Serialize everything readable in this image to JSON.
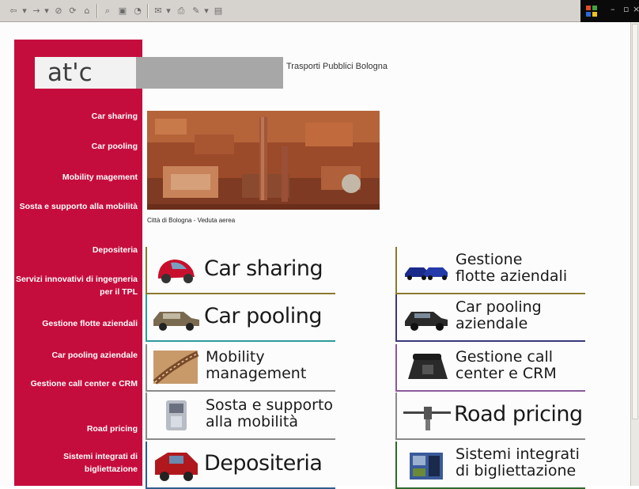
{
  "browser": {
    "toolbar_icons": [
      "back-arrow-icon",
      "forward-arrow-icon",
      "stop-icon",
      "refresh-icon",
      "home-icon",
      "search-icon",
      "favorites-icon",
      "history-icon",
      "mail-icon",
      "print-icon",
      "edit-icon",
      "discuss-icon"
    ]
  },
  "site": {
    "logo": "at'c",
    "title": "Trasporti Pubblici Bologna",
    "accent_color": "#c50d3d"
  },
  "sidebar": {
    "items": [
      {
        "label": "Car sharing"
      },
      {
        "label": "Car pooling"
      },
      {
        "label": "Mobility magement"
      },
      {
        "label": "Sosta e supporto alla mobilità"
      },
      {
        "label": "Depositeria"
      },
      {
        "label": "Servizi innovativi di ingegneria per il TPL"
      },
      {
        "label": "Gestione flotte aziendali"
      },
      {
        "label": "Car pooling aziendale"
      },
      {
        "label": "Gestione call center e CRM"
      },
      {
        "label": "Road pricing"
      },
      {
        "label": "Sistemi integrati di bigliettazione"
      }
    ]
  },
  "photo": {
    "caption": "Città di Bologna - Veduta aerea"
  },
  "tiles": {
    "left": [
      {
        "label": "Car sharing",
        "color": "#8a7a2e"
      },
      {
        "label": "Car pooling",
        "color": "#2e9a9a"
      },
      {
        "label": "Mobility\nmanagement",
        "color": "#8a8a8a"
      },
      {
        "label": "Sosta e supporto\nalla mobilità",
        "color": "#8a8a8a"
      },
      {
        "label": "Depositeria",
        "color": "#2e5e8a"
      }
    ],
    "right": [
      {
        "label": "Gestione\nflotte aziendali",
        "color": "#8a7a2e"
      },
      {
        "label": "Car pooling\naziendale",
        "color": "#3a3a7a"
      },
      {
        "label": "Gestione call\ncenter e CRM",
        "color": "#8a5a9a"
      },
      {
        "label": "Road pricing",
        "color": "#8a8a8a"
      },
      {
        "label": "Sistemi integrati\ndi bigliettazione",
        "color": "#2e6a2e"
      }
    ]
  }
}
